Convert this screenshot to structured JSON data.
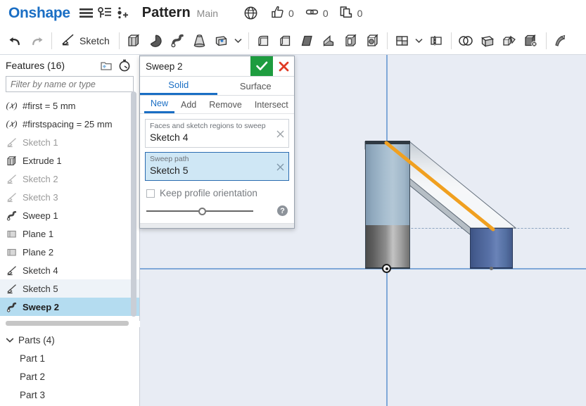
{
  "header": {
    "brand": "Onshape",
    "menu_icon": "hamburger-menu-icon",
    "versions_icon": "version-graph-icon",
    "add_version_icon": "add-version-icon",
    "document_title": "Pattern",
    "branch": "Main",
    "globe_icon": "globe-icon",
    "counters": [
      {
        "icon": "thumbs-up-icon",
        "value": "0"
      },
      {
        "icon": "link-icon",
        "value": "0"
      },
      {
        "icon": "copy-documents-icon",
        "value": "0"
      }
    ]
  },
  "toolbar": {
    "undo_label": "undo-icon",
    "redo_label": "redo-icon",
    "sketch_label": "Sketch",
    "tools": [
      "extrude-icon",
      "revolve-icon",
      "sweep-icon",
      "loft-icon",
      "thicken-icon",
      "fillet-icon",
      "chamfer-icon",
      "draft-icon",
      "rib-icon",
      "shell-icon",
      "hole-icon",
      "pattern-icon",
      "mirror-icon",
      "boolean-icon",
      "split-icon",
      "transform-icon",
      "delete-face-icon",
      "move-face-icon"
    ]
  },
  "features_panel": {
    "title": "Features (16)",
    "new_folder_icon": "new-folder-icon",
    "rollback_icon": "rollback-timer-icon",
    "filter_placeholder": "Filter by name or type",
    "filter_value": "",
    "items": [
      {
        "label": "#first = 5 mm",
        "icon": "variable-icon",
        "state": "normal"
      },
      {
        "label": "#firstspacing = 25 mm",
        "icon": "variable-icon",
        "state": "normal"
      },
      {
        "label": "Sketch 1",
        "icon": "sketch-icon",
        "state": "dim"
      },
      {
        "label": "Extrude 1",
        "icon": "extrude-icon",
        "state": "normal"
      },
      {
        "label": "Sketch 2",
        "icon": "sketch-icon",
        "state": "dim"
      },
      {
        "label": "Sketch 3",
        "icon": "sketch-icon",
        "state": "dim"
      },
      {
        "label": "Sweep 1",
        "icon": "sweep-icon",
        "state": "normal"
      },
      {
        "label": "Plane 1",
        "icon": "plane-icon",
        "state": "normal"
      },
      {
        "label": "Plane 2",
        "icon": "plane-icon",
        "state": "normal"
      },
      {
        "label": "Sketch 4",
        "icon": "sketch-icon",
        "state": "normal"
      },
      {
        "label": "Sketch 5",
        "icon": "sketch-icon",
        "state": "hover"
      },
      {
        "label": "Sweep 2",
        "icon": "sweep-icon",
        "state": "selected"
      }
    ],
    "parts": {
      "header": "Parts (4)",
      "expanded": true,
      "items": [
        "Part 1",
        "Part 2",
        "Part 3"
      ]
    }
  },
  "dialog": {
    "title": "Sweep 2",
    "accept_icon": "checkmark-icon",
    "cancel_icon": "close-icon",
    "main_tabs": [
      {
        "label": "Solid",
        "active": true
      },
      {
        "label": "Surface",
        "active": false
      }
    ],
    "sub_tabs": [
      {
        "label": "New",
        "active": true
      },
      {
        "label": "Add",
        "active": false
      },
      {
        "label": "Remove",
        "active": false
      },
      {
        "label": "Intersect",
        "active": false
      }
    ],
    "fields": [
      {
        "label": "Faces and sketch regions to sweep",
        "value": "Sketch 4",
        "active": false,
        "clear_icon": "clear-icon"
      },
      {
        "label": "Sweep path",
        "value": "Sketch 5",
        "active": true,
        "clear_icon": "clear-icon"
      }
    ],
    "checkbox": {
      "label": "Keep profile orientation",
      "checked": false
    },
    "slider": {
      "position_percent": 49
    },
    "help_icon": "help-icon",
    "help_label": "?"
  },
  "canvas": {
    "background_color": "#e8ecf4",
    "axis_color": "#7fa8d8",
    "sweep_path_color": "#f0a020",
    "origin_icon": "origin-marker-icon",
    "part_colors": {
      "profile_body": "#a8bfd0",
      "base_cylinder": "#8e8e8e",
      "end_cylinder": "#5871a7"
    }
  }
}
